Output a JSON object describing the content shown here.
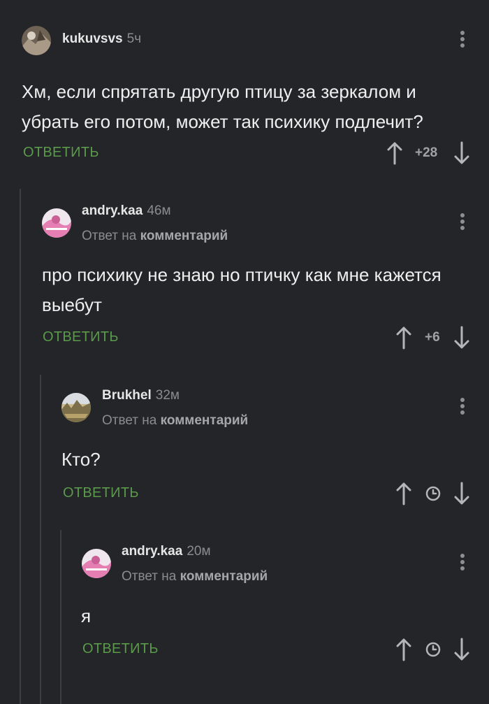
{
  "comments": [
    {
      "user": "kukuvsvs",
      "time": "5ч",
      "reply_to": null,
      "text": "Хм, если спрятать другую птицу за зеркалом и убрать его потом, может так психику подлечит?",
      "reply_label": "ОТВЕТИТЬ",
      "score": "+28"
    },
    {
      "user": "andry.kaa",
      "time": "46м",
      "reply_to": {
        "prefix": "Ответ на",
        "target": "комментарий"
      },
      "text": "про психику не знаю но птичку как мне кажется выебут",
      "reply_label": "ОТВЕТИТЬ",
      "score": "+6"
    },
    {
      "user": "Brukhel",
      "time": "32м",
      "reply_to": {
        "prefix": "Ответ на",
        "target": "комментарий"
      },
      "text": "Кто?",
      "reply_label": "ОТВЕТИТЬ",
      "score": null
    },
    {
      "user": "andry.kaa",
      "time": "20м",
      "reply_to": {
        "prefix": "Ответ на",
        "target": "комментарий"
      },
      "text": "я",
      "reply_label": "ОТВЕТИТЬ",
      "score": null
    }
  ],
  "icons": {
    "upvote": "arrow-up-icon",
    "downvote": "arrow-down-icon",
    "pending_score": "clock-icon",
    "more": "more-vertical-icon"
  },
  "colors": {
    "background": "#232528",
    "reply_button": "#5a9a4a",
    "muted": "#8a8c90",
    "thread_line": "#3c3e42"
  }
}
